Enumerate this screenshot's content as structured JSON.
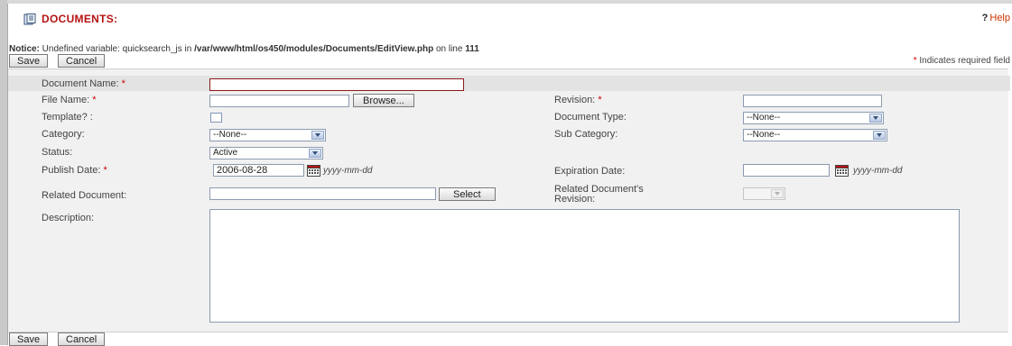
{
  "header": {
    "title": "DOCUMENTS:",
    "help_label": "Help",
    "help_prefix": "?"
  },
  "notice": {
    "prefix": "Notice:",
    "message": " Undefined variable: quicksearch_js in ",
    "path": "/var/www/html/os450/modules/Documents/EditView.php",
    "on_line": " on line ",
    "line": "111"
  },
  "buttons": {
    "save": "Save",
    "cancel": "Cancel",
    "browse": "Browse...",
    "select": "Select"
  },
  "required_note": {
    "star": "*",
    "text": " Indicates required field"
  },
  "form": {
    "document_name": {
      "label": "Document Name:",
      "star": "*",
      "value": ""
    },
    "file_name": {
      "label": "File Name:",
      "star": "*",
      "value": ""
    },
    "revision": {
      "label": "Revision:",
      "star": "*",
      "value": ""
    },
    "template": {
      "label": "Template? :",
      "checked": false
    },
    "document_type": {
      "label": "Document Type:",
      "value": "--None--"
    },
    "category": {
      "label": "Category:",
      "value": "--None--"
    },
    "sub_category": {
      "label": "Sub Category:",
      "value": "--None--"
    },
    "status": {
      "label": "Status:",
      "value": "Active"
    },
    "publish_date": {
      "label": "Publish Date:",
      "star": "*",
      "value": "2006-08-28",
      "format": "yyyy-mm-dd"
    },
    "expiration_date": {
      "label": "Expiration Date:",
      "value": "",
      "format": "yyyy-mm-dd"
    },
    "related_document": {
      "label": "Related Document:",
      "value": ""
    },
    "related_revision": {
      "label_line1": "Related Document's",
      "label_line2": "Revision:",
      "value": ""
    },
    "description": {
      "label": "Description:",
      "value": ""
    }
  },
  "colors": {
    "title": "#b51313",
    "required": "#cc0000",
    "input_border": "#8c9bb0",
    "doc_name_border": "#8b1a1a"
  }
}
